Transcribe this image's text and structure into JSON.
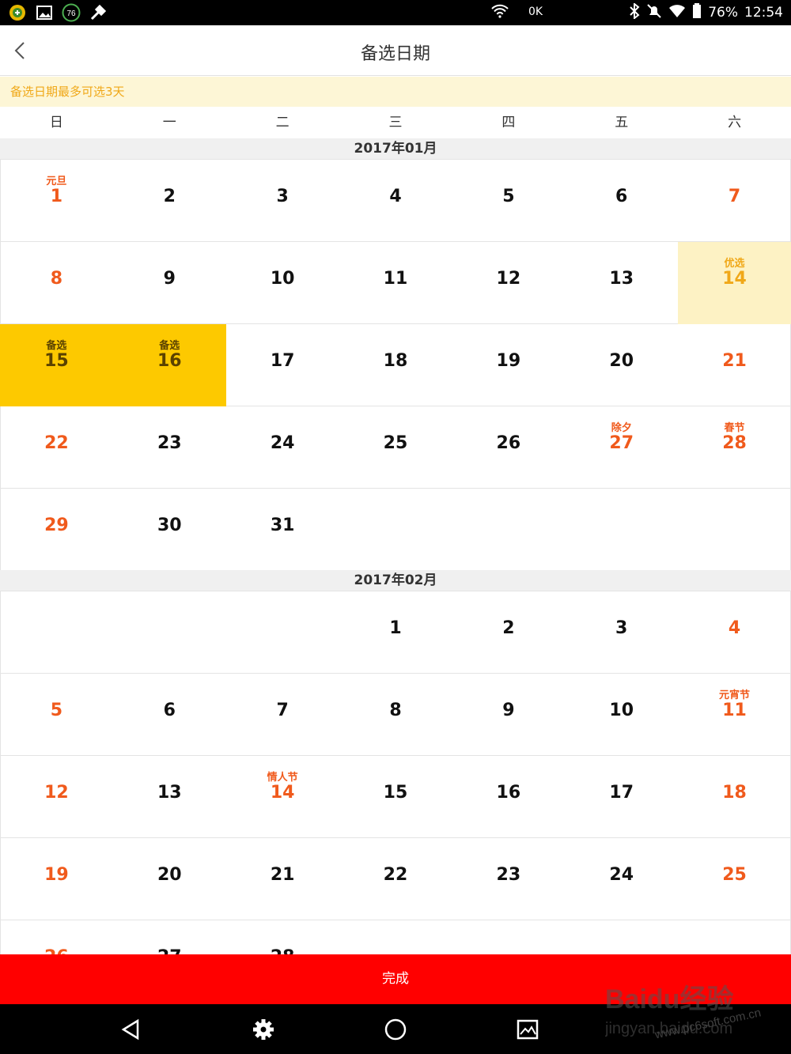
{
  "status_bar": {
    "network_label": "0K",
    "battery": "76%",
    "time": "12:54",
    "left_icons": [
      "app-icon",
      "image-icon",
      "badge-76-icon",
      "wrench-icon"
    ],
    "badge_text": "76"
  },
  "header": {
    "title": "备选日期",
    "back_icon": "chevron-left-icon"
  },
  "notice": {
    "text": "备选日期最多可选3天"
  },
  "weekdays": [
    "日",
    "一",
    "二",
    "三",
    "四",
    "五",
    "六"
  ],
  "months": [
    {
      "title": "2017年01月",
      "first_weekday": 0,
      "days_in_month": 31,
      "labels": {
        "1": "元旦",
        "14": "优选",
        "15": "备选",
        "16": "备选",
        "27": "除夕",
        "28": "春节"
      },
      "holidays": [
        1,
        27,
        28
      ],
      "preferred": [
        14
      ],
      "selected": [
        15,
        16
      ]
    },
    {
      "title": "2017年02月",
      "first_weekday": 3,
      "days_in_month": 28,
      "labels": {
        "11": "元宵节",
        "14": "情人节"
      },
      "holidays": [
        11,
        14
      ],
      "preferred": [],
      "selected": []
    }
  ],
  "footer": {
    "done_label": "完成"
  },
  "nav_bar": [
    "back-triangle-icon",
    "settings-gear-icon",
    "home-circle-icon",
    "gallery-icon"
  ],
  "colors": {
    "accent_red": "#ff0000",
    "weekend_orange": "#f05a1c",
    "selected_yellow": "#fdc900",
    "preferred_yellow": "#fdf2c4",
    "notice_bg": "#fdf6d6"
  },
  "watermark": {
    "line1": "Baidu经验",
    "line2": "jingyan.baidu.com",
    "line3": "www.pc6soft.com.cn"
  }
}
